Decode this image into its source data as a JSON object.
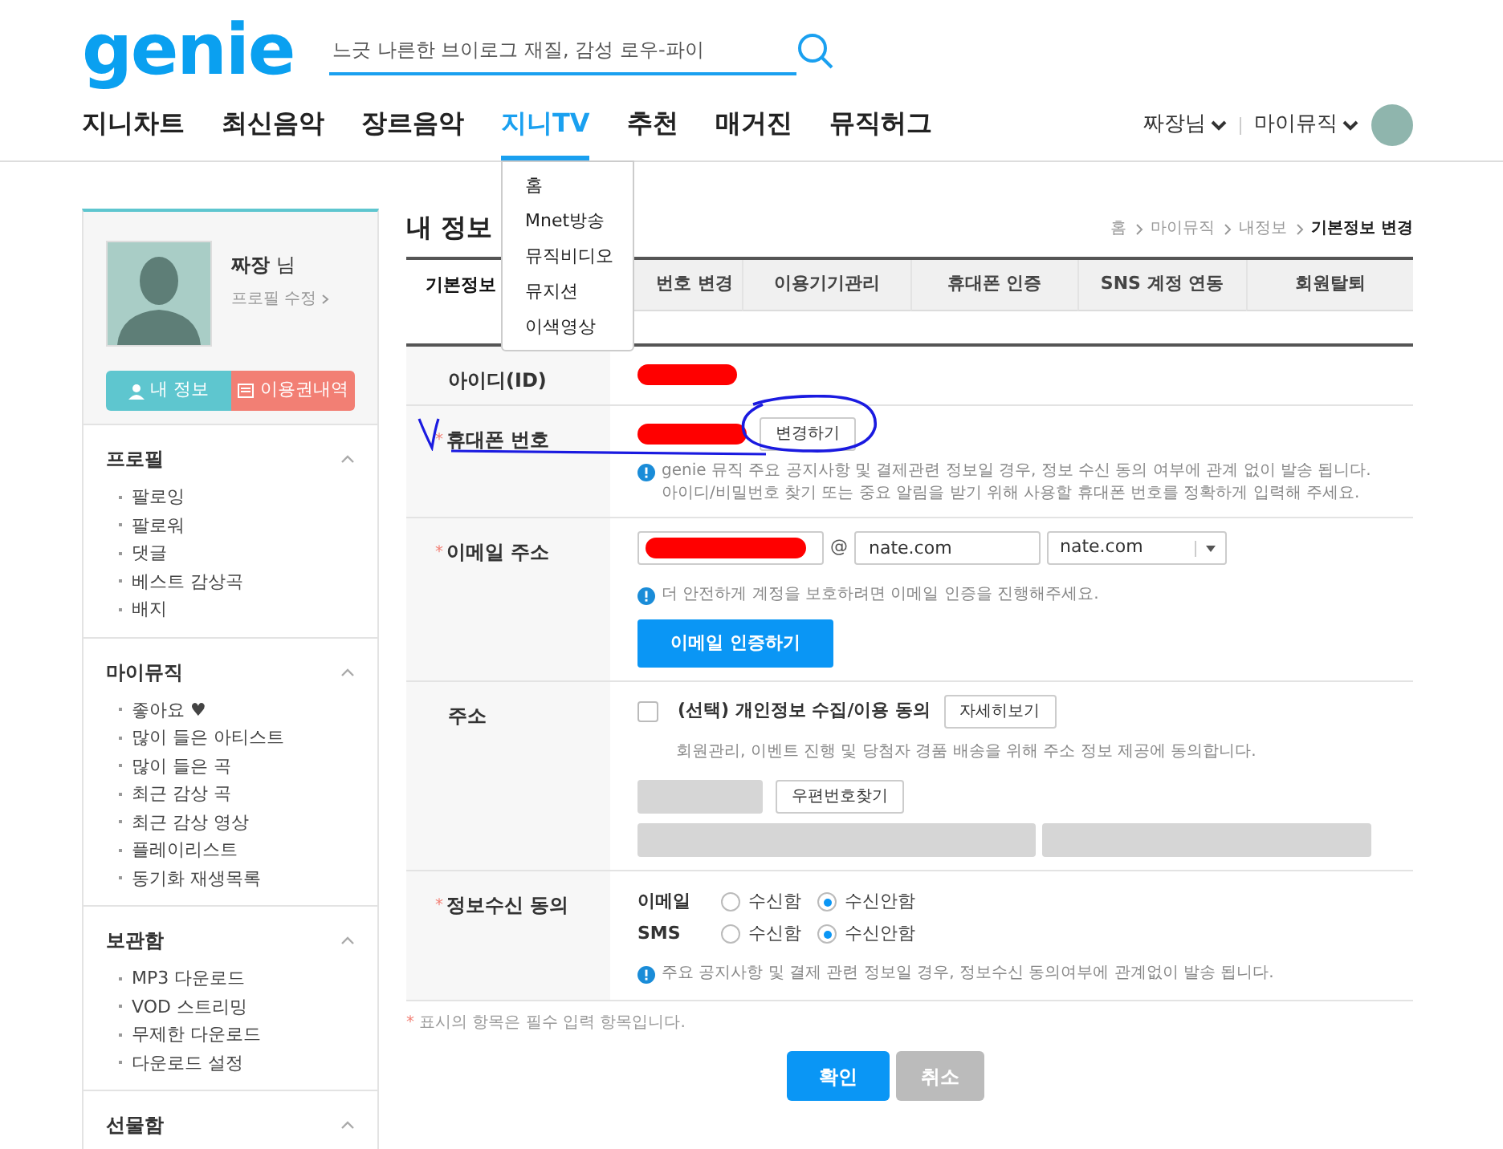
{
  "header": {
    "logo": "genie",
    "search": {
      "placeholder": "느긋 나른한 브이로그 재질, 감성 로우-파이"
    },
    "nav": [
      {
        "label": "지니차트",
        "selected": false
      },
      {
        "label": "최신음악",
        "selected": false
      },
      {
        "label": "장르음악",
        "selected": false
      },
      {
        "label": "지니TV",
        "selected": true,
        "menu": [
          "홈",
          "Mnet방송",
          "뮤직비디오",
          "뮤지션",
          "이색영상"
        ]
      },
      {
        "label": "추천",
        "selected": false
      },
      {
        "label": "매거진",
        "selected": false
      },
      {
        "label": "뮤직허그",
        "selected": false
      }
    ],
    "user_menu": [
      "짜장님",
      "마이뮤직"
    ]
  },
  "sidebar": {
    "profile": {
      "name": "**짜장** 님",
      "edit_link": "프로필 수정"
    },
    "buttons": [
      {
        "label": "내 정보",
        "kind": "info",
        "color": "#5ec6cf"
      },
      {
        "label": "이용권내역",
        "kind": "ticket",
        "color": "#f27f74"
      }
    ],
    "sections": [
      {
        "title": "프로필",
        "expanded": true,
        "items": [
          "팔로잉",
          "팔로워",
          "댓글",
          "베스트 감상곡",
          "배지"
        ]
      },
      {
        "title": "마이뮤직",
        "expanded": true,
        "items": [
          "좋아요 ♥",
          "많이 들은 아티스트",
          "많이 들은 곡",
          "최근 감상 곡",
          "최근 감상 영상",
          "플레이리스트",
          "동기화 재생목록"
        ]
      },
      {
        "title": "보관함",
        "expanded": true,
        "items": [
          "MP3 다운로드",
          "VOD 스트리밍",
          "무제한 다운로드",
          "다운로드 설정"
        ]
      },
      {
        "title": "선물함",
        "expanded": true
      }
    ]
  },
  "page": {
    "title": "내 정보",
    "required_mark": "*",
    "breadcrumb": [
      {
        "label": "홈",
        "current": false
      },
      {
        "label": "마이뮤직",
        "current": false
      },
      {
        "label": "내정보",
        "current": false
      },
      {
        "label": "기본정보 변경",
        "current": true
      }
    ],
    "tabs": [
      {
        "label": "기본정보",
        "selected": true
      },
      {
        "label": "번호 변경",
        "selected": false
      },
      {
        "label": "이용기기관리",
        "selected": false
      },
      {
        "label": "휴대폰 인증",
        "selected": false
      },
      {
        "label": "SNS 계정 연동",
        "selected": false
      },
      {
        "label": "회원탈퇴",
        "selected": false
      }
    ],
    "form": [
      {
        "kind": "id",
        "label": "아이디(ID)",
        "required": false,
        "value_redacted": true
      },
      {
        "kind": "phone",
        "label": "휴대폰 번호",
        "required": true,
        "value_redacted": true,
        "button": "변경하기",
        "hints": [
          "genie 뮤직 주요 공지사항 및 결제관련 정보일 경우, 정보 수신 동의 여부에 관계 없이 발송 됩니다.",
          "아이디/비밀번호 찾기 또는 중요 알림을 받기 위해 사용할 휴대폰 번호를 정확하게 입력해 주세요."
        ]
      },
      {
        "kind": "email",
        "label": "이메일 주소",
        "required": true,
        "local_redacted": true,
        "at": "@",
        "domain": "nate.com",
        "domain_select": "nate.com",
        "hint": "더 안전하게 계정을 보호하려면 이메일 인증을 진행해주세요.",
        "button": "이메일 인증하기"
      },
      {
        "kind": "address",
        "label": "주소",
        "required": false,
        "consent": {
          "label": "(선택) 개인정보 수집/이용 동의",
          "checked": false
        },
        "detail_button": "자세히보기",
        "hint": "회원관리, 이벤트 진행 및 당첨자 경품 배송을 위해 주소 정보 제공에 동의합니다.",
        "zip_button": "우편번호찾기",
        "disabled": true
      },
      {
        "kind": "consent",
        "label": "정보수신 동의",
        "required": true,
        "channels": [
          {
            "name": "이메일",
            "options": [
              {
                "label": "수신함",
                "selected": false
              },
              {
                "label": "수신안함",
                "selected": true
              }
            ]
          },
          {
            "name": "SMS",
            "options": [
              {
                "label": "수신함",
                "selected": false
              },
              {
                "label": "수신안함",
                "selected": true
              }
            ]
          }
        ],
        "hint": "주요 공지사항 및 결제 관련 정보일 경우, 정보수신 동의여부에 관계없이 발송 됩니다."
      }
    ],
    "note": "표시의 항목은 필수 입력 항목입니다.",
    "buttons": [
      {
        "label": "확인",
        "kind": "primary"
      },
      {
        "label": "취소",
        "kind": "secondary"
      }
    ]
  }
}
